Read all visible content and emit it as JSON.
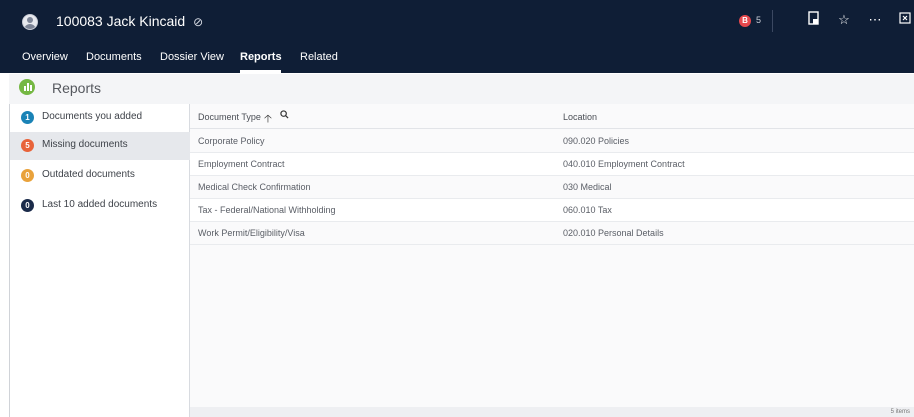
{
  "header": {
    "title": "100083 Jack Kincaid",
    "title_icon": "⊘",
    "notification_count": "5",
    "notification_badge": "B"
  },
  "tabs": [
    {
      "label": "Overview",
      "active": false
    },
    {
      "label": "Documents",
      "active": false
    },
    {
      "label": "Dossier View",
      "active": false
    },
    {
      "label": "Reports",
      "active": true
    },
    {
      "label": "Related",
      "active": false
    }
  ],
  "page": {
    "title": "Reports"
  },
  "left_list": [
    {
      "count": "1",
      "label": "Documents you added",
      "color": "#1a83b6"
    },
    {
      "count": "5",
      "label": "Missing documents",
      "color": "#e8633a"
    },
    {
      "count": "0",
      "label": "Outdated documents",
      "color": "#e9a23b"
    },
    {
      "count": "0",
      "label": "Last 10 added documents",
      "color": "#1b2b4a"
    }
  ],
  "table": {
    "columns": [
      "Document Type",
      "Location"
    ],
    "rows": [
      [
        "Corporate Policy",
        "090.020 Policies"
      ],
      [
        "Employment Contract",
        "040.010 Employment Contract"
      ],
      [
        "Medical Check Confirmation",
        "030 Medical"
      ],
      [
        "Tax - Federal/National Withholding",
        "060.010 Tax"
      ],
      [
        "Work Permit/Eligibility/Visa",
        "020.010 Personal Details"
      ]
    ],
    "footer": "5 items"
  },
  "colors": {
    "header_bg": "#0f1e36",
    "reports_icon": "#75b843",
    "selected_row": "#e6e8ec"
  }
}
